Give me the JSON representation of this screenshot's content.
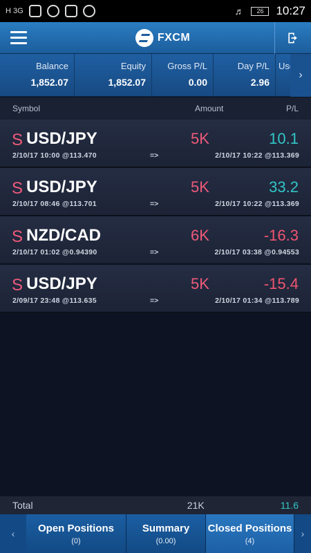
{
  "status_bar": {
    "signal": "H 3G",
    "battery": "26",
    "time": "10:27"
  },
  "header": {
    "brand": "FXCM"
  },
  "summary": [
    {
      "label": "Balance",
      "value": "1,852.07"
    },
    {
      "label": "Equity",
      "value": "1,852.07"
    },
    {
      "label": "Gross P/L",
      "value": "0.00"
    },
    {
      "label": "Day P/L",
      "value": "2.96"
    },
    {
      "label": "Used M",
      "value": ""
    }
  ],
  "columns": {
    "symbol": "Symbol",
    "amount": "Amount",
    "pl": "P/L"
  },
  "positions": [
    {
      "side": "S",
      "symbol": "USD/JPY",
      "amount": "5K",
      "pl": "10.1",
      "pl_sign": "pos",
      "open": "2/10/17 10:00 @113.470",
      "arrow": "=>",
      "close": "2/10/17 10:22 @113.369"
    },
    {
      "side": "S",
      "symbol": "USD/JPY",
      "amount": "5K",
      "pl": "33.2",
      "pl_sign": "pos",
      "open": "2/10/17 08:46 @113.701",
      "arrow": "=>",
      "close": "2/10/17 10:22 @113.369"
    },
    {
      "side": "S",
      "symbol": "NZD/CAD",
      "amount": "6K",
      "pl": "-16.3",
      "pl_sign": "neg",
      "open": "2/10/17 01:02 @0.94390",
      "arrow": "=>",
      "close": "2/10/17 03:38 @0.94553"
    },
    {
      "side": "S",
      "symbol": "USD/JPY",
      "amount": "5K",
      "pl": "-15.4",
      "pl_sign": "neg",
      "open": "2/09/17 23:48 @113.635",
      "arrow": "=>",
      "close": "2/10/17 01:34 @113.789"
    }
  ],
  "total": {
    "label": "Total",
    "amount": "21K",
    "pl": "11.6"
  },
  "tabs": [
    {
      "label": "Open Positions",
      "count": "(0)"
    },
    {
      "label": "Summary",
      "count": "(0.00)"
    },
    {
      "label": "Closed Positions",
      "count": "(4)"
    }
  ],
  "colors": {
    "accent": "#1c5d9c",
    "positive": "#32c7c7",
    "negative": "#f05470",
    "sell": "#ef5a7a"
  }
}
